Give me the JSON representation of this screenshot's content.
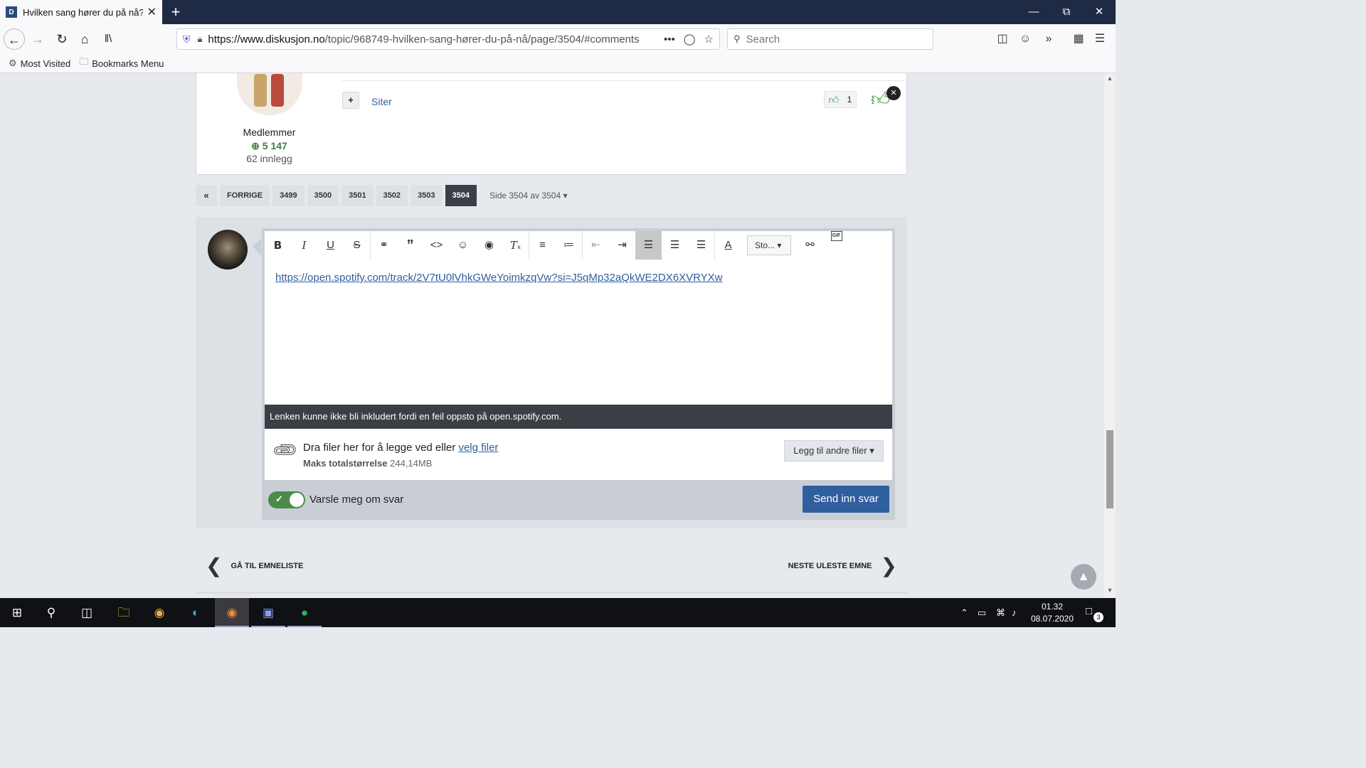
{
  "browser": {
    "tab_title": "Hvilken sang hører du på nå? -",
    "tab_close": "✕",
    "new_tab": "+",
    "url_host": "https://www.diskusjon.no",
    "url_path": "/topic/968749-hvilken-sang-hører-du-på-nå/page/3504/#comments",
    "search_placeholder": "Search",
    "bookmarks": [
      {
        "label": "Most Visited",
        "icon": "gear-icon"
      },
      {
        "label": "Bookmarks Menu",
        "icon": "folder-icon"
      }
    ]
  },
  "post": {
    "role": "Medlemmer",
    "reputation": "5 147",
    "post_count": "62 innlegg",
    "plus": "+",
    "quote_label": "Siter",
    "reaction_count": "1",
    "remove_reaction": "✕"
  },
  "pagination": {
    "first": "«",
    "prev": "FORRIGE",
    "pages": [
      "3499",
      "3500",
      "3501",
      "3502",
      "3503",
      "3504"
    ],
    "active_page": "3504",
    "info": "Side 3504 av 3504 ▾"
  },
  "editor": {
    "style_select": "Sto...",
    "content_link": "https://open.spotify.com/track/2V7tU0lVhkGWeYoimkzqVw?si=J5qMp32aQkWE2DX6XVRYXw",
    "error_message": "Lenken kunne ikke bli inkludert fordi en feil oppsto på open.spotify.com.",
    "attach_text": "Dra filer her for å legge ved eller",
    "attach_link": "velg filer",
    "max_label": "Maks totalstørrelse",
    "max_value": "244,14MB",
    "add_files": "Legg til andre filer ▾",
    "notify_label": "Varsle meg om svar",
    "notify_on": true,
    "submit": "Send inn svar"
  },
  "footer_nav": {
    "back": "GÅ TIL EMNELISTE",
    "next": "NESTE ULESTE EMNE"
  },
  "taskbar": {
    "time": "01.32",
    "date": "08.07.2020",
    "notifications": "3"
  },
  "colors": {
    "accent": "#2f5f9e",
    "positive": "#3d9c3d",
    "tabbar": "#1f2a44"
  }
}
